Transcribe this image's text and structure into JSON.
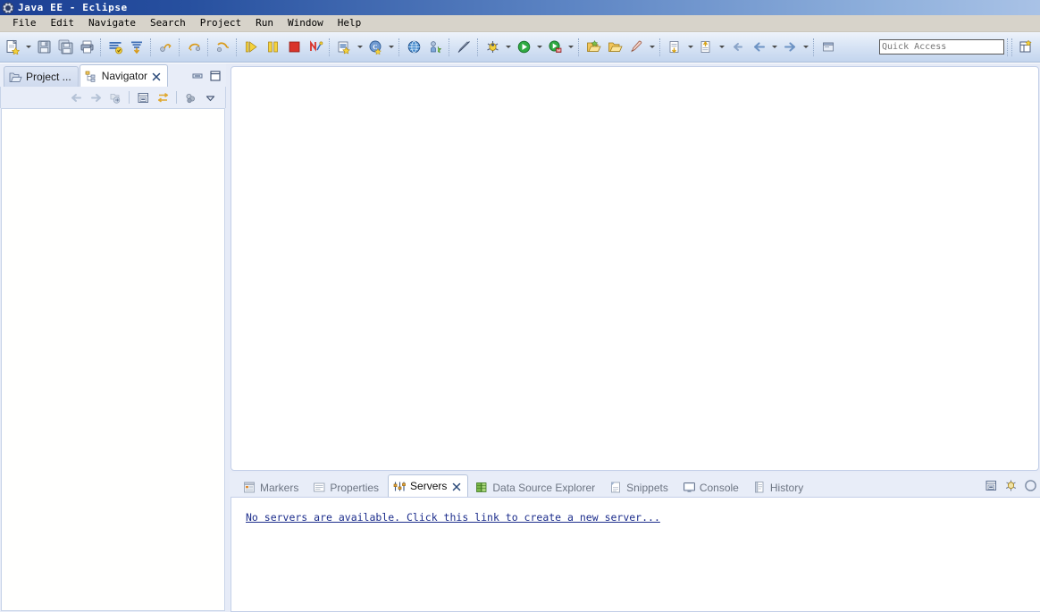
{
  "window": {
    "title": "Java EE - Eclipse",
    "icon": "eclipse-icon"
  },
  "menubar": {
    "items": [
      {
        "label": "File"
      },
      {
        "label": "Edit"
      },
      {
        "label": "Navigate"
      },
      {
        "label": "Search"
      },
      {
        "label": "Project"
      },
      {
        "label": "Run"
      },
      {
        "label": "Window"
      },
      {
        "label": "Help"
      }
    ]
  },
  "toolbar": {
    "groups": [
      {
        "buttons": [
          {
            "name": "new-wizard-button",
            "icon": "new-file-icon",
            "dropdown": true
          },
          {
            "name": "save-button",
            "icon": "save-icon",
            "dropdown": false
          },
          {
            "name": "save-all-button",
            "icon": "save-all-icon",
            "dropdown": false
          },
          {
            "name": "print-button",
            "icon": "print-icon",
            "dropdown": false
          }
        ]
      },
      {
        "buttons": [
          {
            "name": "build-all-button",
            "icon": "build-all-icon",
            "dropdown": false
          },
          {
            "name": "publish-button",
            "icon": "publish-icon",
            "dropdown": false
          }
        ]
      },
      {
        "buttons": [
          {
            "name": "skip-all-breakpoints-button",
            "icon": "skip-breakpoints-icon",
            "dropdown": false
          }
        ]
      },
      {
        "buttons": [
          {
            "name": "resume-button",
            "icon": "resume-icon",
            "dropdown": false
          }
        ]
      },
      {
        "buttons": [
          {
            "name": "step-return-button",
            "icon": "step-return-icon",
            "dropdown": false
          }
        ]
      },
      {
        "buttons": [
          {
            "name": "run-debug-button",
            "icon": "run-forward-icon",
            "dropdown": false
          },
          {
            "name": "suspend-button",
            "icon": "pause-icon",
            "dropdown": false
          },
          {
            "name": "terminate-button",
            "icon": "stop-icon",
            "dropdown": false
          },
          {
            "name": "disconnect-button",
            "icon": "disconnect-icon",
            "dropdown": false
          }
        ]
      },
      {
        "buttons": [
          {
            "name": "new-java-project-button",
            "icon": "java-project-icon",
            "dropdown": true
          },
          {
            "name": "new-class-button",
            "icon": "new-class-icon",
            "dropdown": true
          }
        ]
      },
      {
        "buttons": [
          {
            "name": "open-web-browser-button",
            "icon": "globe-icon",
            "dropdown": false
          },
          {
            "name": "new-connection-button",
            "icon": "connection-icon",
            "dropdown": false
          }
        ]
      },
      {
        "buttons": [
          {
            "name": "toggle-breakpoint-button",
            "icon": "pen-slash-icon",
            "dropdown": false
          }
        ]
      },
      {
        "buttons": [
          {
            "name": "debug-button",
            "icon": "bug-icon",
            "dropdown": true
          },
          {
            "name": "run-button",
            "icon": "run-green-icon",
            "dropdown": true
          },
          {
            "name": "profile-button",
            "icon": "profile-icon",
            "dropdown": true
          }
        ]
      },
      {
        "buttons": [
          {
            "name": "open-type-button",
            "icon": "open-folder-star-icon",
            "dropdown": false
          },
          {
            "name": "open-task-button",
            "icon": "open-folder-icon",
            "dropdown": false
          },
          {
            "name": "search-button",
            "icon": "search-pin-icon",
            "dropdown": true
          }
        ]
      },
      {
        "buttons": [
          {
            "name": "next-annotation-button",
            "icon": "next-annotation-icon",
            "dropdown": true
          },
          {
            "name": "previous-annotation-button",
            "icon": "prev-annotation-icon",
            "dropdown": true
          },
          {
            "name": "last-edit-location-button",
            "icon": "last-edit-icon",
            "dropdown": false
          },
          {
            "name": "back-button",
            "icon": "arrow-left-icon",
            "dropdown": true
          },
          {
            "name": "forward-button",
            "icon": "arrow-right-icon",
            "dropdown": true
          }
        ]
      },
      {
        "buttons": [
          {
            "name": "new-editor-button",
            "icon": "new-editor-icon",
            "dropdown": false
          }
        ]
      }
    ],
    "quick_access": {
      "name": "quick-access-input",
      "placeholder": "Quick Access",
      "value": ""
    },
    "perspective_button": {
      "name": "open-perspective-button",
      "icon": "open-perspective-icon"
    }
  },
  "left_panel": {
    "tabs": [
      {
        "label": "Project ...",
        "icon": "project-explorer-icon",
        "active": false,
        "closable": false
      },
      {
        "label": "Navigator",
        "icon": "navigator-icon",
        "active": true,
        "closable": true
      }
    ],
    "stack_buttons": [
      {
        "name": "minimize-view-button",
        "icon": "minimize-icon"
      },
      {
        "name": "maximize-view-button",
        "icon": "maximize-icon"
      }
    ],
    "view_toolbar": [
      {
        "name": "back-button",
        "icon": "arrow-left-icon"
      },
      {
        "name": "forward-button",
        "icon": "arrow-right-icon"
      },
      {
        "name": "home-button",
        "icon": "home-icon"
      },
      {
        "name": "collapse-all-button",
        "icon": "collapse-all-icon"
      },
      {
        "name": "link-with-editor-button",
        "icon": "link-editor-icon"
      },
      {
        "name": "filters-button",
        "icon": "filters-icon"
      },
      {
        "name": "view-menu-button",
        "icon": "chevron-down-icon"
      }
    ],
    "body_content": ""
  },
  "editor": {
    "name": "editor-area",
    "content": ""
  },
  "bottom_panel": {
    "tabs": [
      {
        "label": "Markers",
        "icon": "markers-icon",
        "active": false,
        "closable": false
      },
      {
        "label": "Properties",
        "icon": "properties-icon",
        "active": false,
        "closable": false
      },
      {
        "label": "Servers",
        "icon": "servers-icon",
        "active": true,
        "closable": true
      },
      {
        "label": "Data Source Explorer",
        "icon": "data-source-icon",
        "active": false,
        "closable": false
      },
      {
        "label": "Snippets",
        "icon": "snippets-icon",
        "active": false,
        "closable": false
      },
      {
        "label": "Console",
        "icon": "console-icon",
        "active": false,
        "closable": false
      },
      {
        "label": "History",
        "icon": "history-icon",
        "active": false,
        "closable": false
      }
    ],
    "view_buttons": [
      {
        "name": "collapse-all-button",
        "icon": "collapse-all-icon"
      },
      {
        "name": "debug-server-button",
        "icon": "debug-bug-icon"
      },
      {
        "name": "start-server-button",
        "icon": "start-circle-icon"
      }
    ],
    "server_message": "No servers are available. Click this link to create a new server..."
  },
  "colors": {
    "title_start": "#1c3f94",
    "title_end": "#a9c2e6",
    "menu_bg": "#d7d3ca",
    "toolbar_bg": "#cddcf1",
    "workbench_bg": "#e6ebf7",
    "link": "#1c2d8c",
    "editor_bg": "#ffffff"
  }
}
